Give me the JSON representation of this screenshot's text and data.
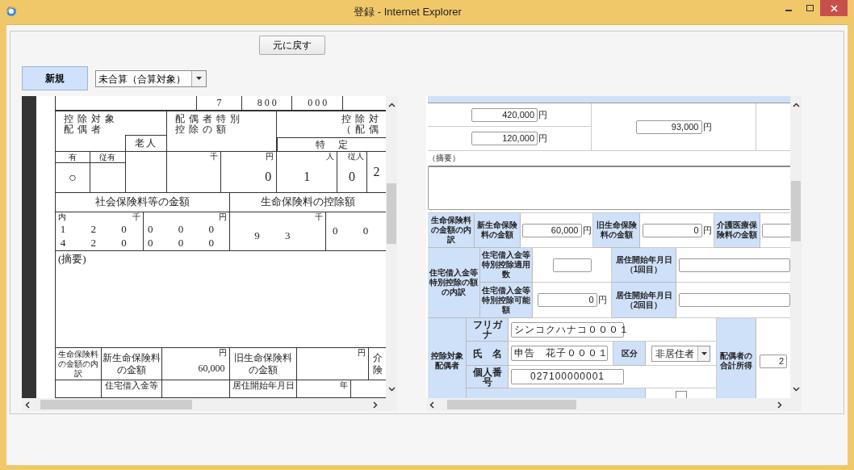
{
  "window": {
    "title": "登録 - Internet Explorer"
  },
  "toolbar": {
    "back_button": "元に戻す",
    "status_label": "新規",
    "mode_select": {
      "value": "未合算（合算対象）"
    }
  },
  "document_viewer": {
    "strips": [
      {
        "cells": [
          {},
          {
            "text": "7"
          },
          {
            "text": "8 0 0"
          },
          {
            "text": "0 0 0"
          },
          {}
        ]
      },
      {
        "cells": [
          {
            "text": "控除対象配偶者",
            "sub": "老人"
          },
          {
            "text": "配偶者特別控除の額"
          },
          {
            "text": "控除対（配偶",
            "sub": "特　定"
          }
        ]
      },
      {
        "cells": [
          {
            "head": "有",
            "text": "○"
          },
          {
            "head": "従有"
          },
          {},
          {
            "unit": "千"
          },
          {
            "unit": "円",
            "text": "0"
          },
          {
            "unit": "人",
            "text": "1"
          },
          {
            "unit": "従人",
            "text": "0"
          },
          {
            "text": "2"
          }
        ]
      },
      {
        "cells": [
          {
            "text": "社会保険料等の金額"
          },
          {
            "text": "生命保険料の控除額"
          }
        ]
      },
      {
        "cells": [
          {
            "note": "内",
            "unit": "千",
            "text": "1 2 0\n4 2 0"
          },
          {
            "unit": "円",
            "text": "0 0 0\n0 0 0"
          },
          {
            "unit": "千",
            "text": "9 3"
          },
          {
            "text": "0 0"
          }
        ]
      },
      {
        "cells": [
          {
            "text": "(摘要)"
          }
        ]
      },
      {
        "cells": [
          {
            "text": "生命保険料の金額の内訳"
          },
          {
            "text": "新生命保険料の金額"
          },
          {
            "unit": "円",
            "text": "60,000"
          },
          {
            "text": "旧生命保険料の金額"
          },
          {
            "unit": "円"
          },
          {
            "text": "介険"
          }
        ]
      },
      {
        "cells": [
          {},
          {
            "text": "住宅借入金等"
          },
          {},
          {
            "text": "居住開始年月日"
          },
          {
            "unit": "年"
          },
          {}
        ]
      }
    ]
  },
  "entry_form": {
    "amounts": [
      {
        "value": "420,000",
        "unit": "円"
      },
      {
        "value": "120,000",
        "unit": "円"
      },
      {
        "value": "93,000",
        "unit": "円"
      }
    ],
    "remarks": {
      "label": "（摘要）"
    },
    "life_insurance": {
      "heading": "生命保険料の金額の内訳",
      "items": [
        {
          "label": "新生命保険料の金額",
          "value": "60,000",
          "unit": "円"
        },
        {
          "label": "旧生命保険料の金額",
          "value": "0",
          "unit": "円"
        },
        {
          "label": "介護医療保険料の金額"
        }
      ]
    },
    "housing": {
      "heading": "住宅借入金等特別控除の額の内訳",
      "rows": [
        {
          "label": "住宅借入金等特別控除適用数",
          "date_label": "居住開始年月日（1回目）"
        },
        {
          "label": "住宅借入金等特別控除可能額",
          "value": "0",
          "unit": "円",
          "date_label": "居住開始年月日（2回目）"
        }
      ]
    },
    "spouse": {
      "heading": "控除対象配偶者",
      "furigana_label": "フリガナ",
      "furigana": "シンコクハナコ０００１",
      "name_label": "氏　名",
      "name": "申告　花子０００１",
      "category_label": "区分",
      "category": "非居住者",
      "number_label": "個人番号",
      "number": "027100000001",
      "income_label": "配偶者の合計所得",
      "income": "2",
      "checkbox": {
        "checked": false
      }
    }
  }
}
